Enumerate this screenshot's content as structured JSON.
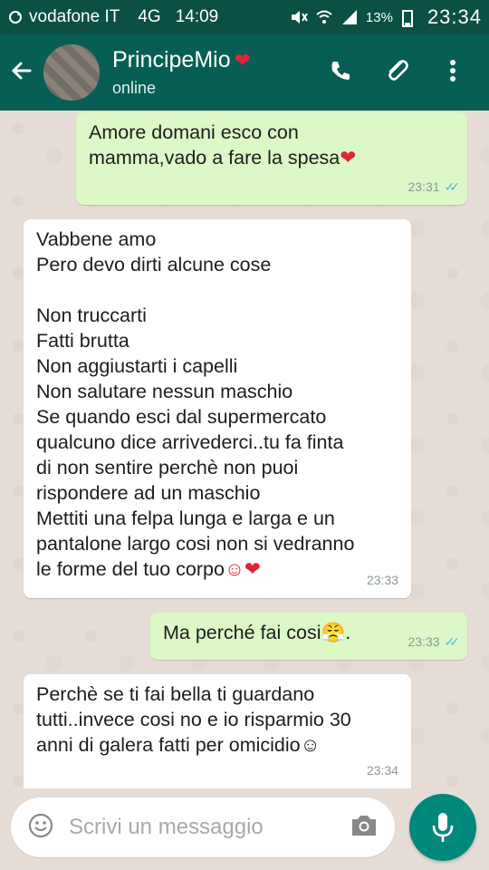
{
  "status_bar": {
    "carrier": "vodafone IT",
    "network": "4G",
    "time_left": "14:09",
    "battery": "13%",
    "time_right": "23:34"
  },
  "header": {
    "contact_name": "PrincipeMio",
    "contact_status": "online",
    "icons": [
      "back-arrow-icon",
      "phone-icon",
      "paperclip-icon",
      "more-vert-icon"
    ]
  },
  "messages": [
    {
      "direction": "out",
      "text": "Amore domani esco con\nmamma,vado a fare la spesa",
      "emoji": "❤",
      "time": "23:31",
      "ticks": "✓✓"
    },
    {
      "direction": "in",
      "text": "Vabbene amo\nPero devo dirti alcune cose\n\nNon truccarti\nFatti brutta\nNon aggiustarti i capelli\nNon salutare nessun maschio\nSe quando esci dal supermercato\nqualcuno dice arrivederci..tu fa finta\ndi non sentire perchè non puoi\nrispondere ad un maschio\nMettiti una felpa lunga e larga e un\npantalone largo cosi non si vedranno\nle forme del tuo corpo",
      "emoji": "☺❤",
      "time": "23:33"
    },
    {
      "direction": "out",
      "text": "Ma perché fai cosi",
      "emoji": "😤.",
      "time": "23:33",
      "ticks": "✓✓"
    },
    {
      "direction": "in",
      "text": "Perchè se ti fai bella ti guardano\ntutti..invece cosi no e io risparmio 30\nanni di galera fatti per omicidio",
      "emoji": "☺",
      "time": "23:34"
    }
  ],
  "input": {
    "placeholder": "Scrivi un messaggio"
  },
  "colors": {
    "header": "#075e54",
    "status_bar": "#0b4f45",
    "outgoing_bubble": "#dcf8c6",
    "incoming_bubble": "#ffffff",
    "mic_button": "#00897b",
    "read_ticks": "#4fb7e8"
  }
}
